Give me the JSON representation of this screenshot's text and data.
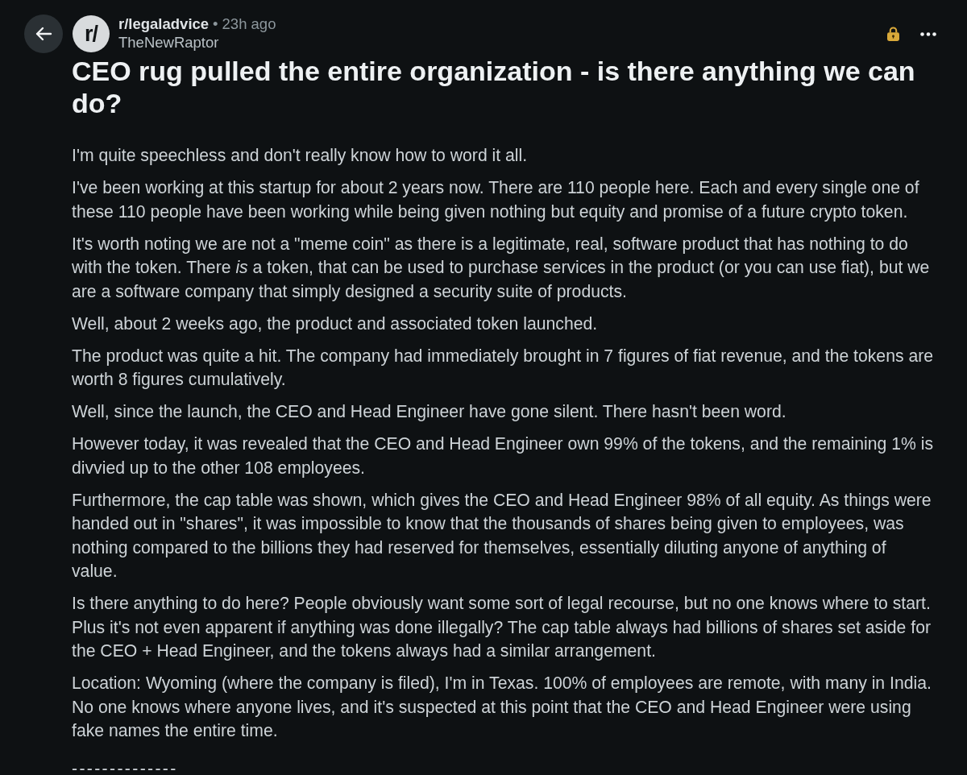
{
  "header": {
    "avatar_text": "r/",
    "subreddit": "r/legaladvice",
    "separator": "•",
    "time": "23h ago",
    "author": "TheNewRaptor",
    "locked": true
  },
  "post": {
    "title": "CEO rug pulled the entire organization - is there anything we can do?",
    "paragraphs": [
      "I'm quite speechless and don't really know how to word it all.",
      "I've been working at this startup for about 2 years now. There are 110 people here. Each and every single one of these 110 people have been working while being given nothing but equity and promise of a future crypto token.",
      "It's worth noting we are not a \"meme coin\" as there is a legitimate, real, software product that has nothing to do with the token. There *is* a token, that can be used to purchase services in the product (or you can use fiat), but we are a software company that simply designed a security suite of products.",
      "Well, about 2 weeks ago, the product and associated token launched.",
      "The product was quite a hit. The company had immediately brought in 7 figures of fiat revenue, and the tokens are worth 8 figures cumulatively.",
      "Well, since the launch, the CEO and Head Engineer have gone silent. There hasn't been word.",
      "However today, it was revealed that the CEO and Head Engineer own 99% of the tokens, and the remaining 1% is divvied up to the other 108 employees.",
      "Furthermore, the cap table was shown, which gives the CEO and Head Engineer 98% of all equity. As things were handed out in \"shares\", it was impossible to know that the thousands of shares being given to employees, was nothing compared to the billions they had reserved for themselves, essentially diluting anyone of anything of value.",
      "Is there anything to do here? People obviously want some sort of legal recourse, but no one knows where to start. Plus it's not even apparent if anything was done illegally? The cap table always had billions of shares set aside for the CEO + Head Engineer, and the tokens always had a similar arrangement.",
      "Location: Wyoming (where the company is filed), I'm in Texas. 100% of employees are remote, with many in India. No one knows where anyone lives, and it's suspected at this point that the CEO and Head Engineer were using fake names the entire time."
    ],
    "divider": "--------------"
  }
}
